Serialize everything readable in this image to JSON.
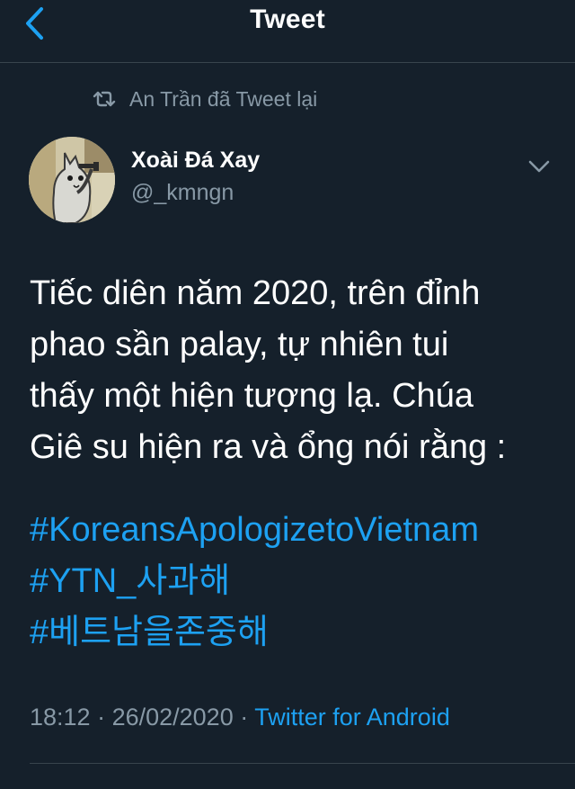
{
  "header": {
    "title": "Tweet",
    "back_icon": "chevron-left-icon"
  },
  "retweet": {
    "icon": "retweet-icon",
    "text": "An Trần đã Tweet lại"
  },
  "author": {
    "display_name": "Xoài Đá Xay",
    "handle": "@_kmngn",
    "avatar": "cartoon-cat-avatar"
  },
  "tweet": {
    "text_lines": [
      "Tiếc diên năm 2020, trên đỉnh",
      "phao sần palay, tự nhiên tui",
      "thấy một hiện tượng lạ. Chúa",
      "Giê su hiện ra và ổng nói rằng :"
    ],
    "hashtags": [
      "#KoreansApologizetoVietnam",
      "#YTN_사과해",
      "#베트남을존중해"
    ]
  },
  "meta": {
    "time": "18:12",
    "separator": " · ",
    "date": "26/02/2020",
    "source": "Twitter for Android"
  },
  "colors": {
    "background": "#15202b",
    "text": "#ffffff",
    "muted": "#8899a6",
    "accent": "#1da1f2",
    "divider": "#38444d"
  }
}
